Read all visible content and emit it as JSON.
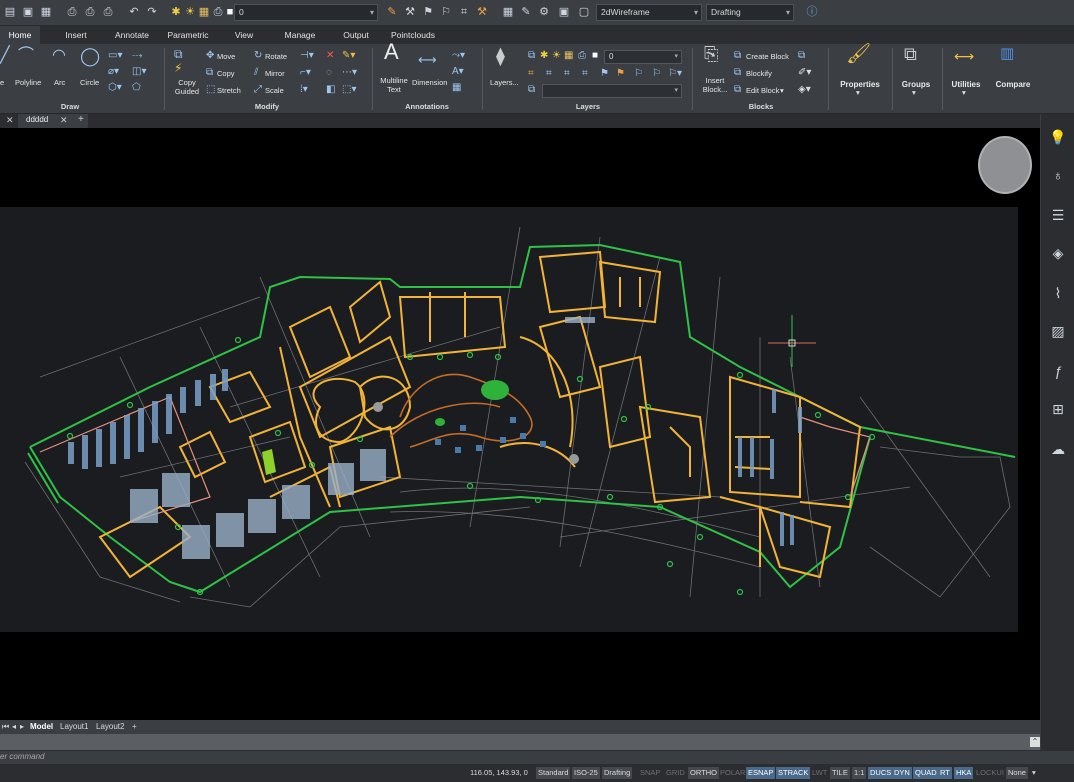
{
  "qat": {
    "layer_value": "0",
    "visual_style": "2dWireframe",
    "workspace": "Drafting"
  },
  "tabs": [
    "Home",
    "Insert",
    "Annotate",
    "Parametric",
    "View",
    "Manage",
    "Output",
    "Pointclouds"
  ],
  "ribbon": {
    "draw": {
      "label": "Draw",
      "line": "e",
      "polyline": "Polyline",
      "arc": "Arc",
      "circle": "Circle"
    },
    "modify": {
      "label": "Modify",
      "copy_guided": "Copy Guided",
      "move": "Move",
      "copy": "Copy",
      "stretch": "Stretch",
      "rotate": "Rotate",
      "mirror": "Mirror",
      "scale": "Scale"
    },
    "annotations": {
      "label": "Annotations",
      "mtext": "Multiline Text",
      "dimension": "Dimension"
    },
    "layers": {
      "label": "Layers",
      "layers_btn": "Layers...",
      "layer_value": "0"
    },
    "blocks": {
      "label": "Blocks",
      "insert": "Insert Block...",
      "create": "Create Block",
      "blockify": "Blockify",
      "edit": "Edit Block"
    },
    "properties": "Properties",
    "groups": "Groups",
    "utilities": "Utilities",
    "compare": "Compare"
  },
  "doc_tab": "ddddd",
  "layout_tabs": [
    "Model",
    "Layout1",
    "Layout2"
  ],
  "command_prompt": "er command",
  "status": {
    "coords": "116.05, 143.93, 0",
    "text_style": "Standard",
    "dim_style": "ISO-25",
    "workspace": "Drafting",
    "toggles": [
      "SNAP",
      "GRID",
      "ORTHO",
      "POLAR",
      "ESNAP",
      "STRACK",
      "LWT",
      "TILE",
      "1:1",
      "DUCS",
      "DYN",
      "QUAD",
      "RT",
      "HKA",
      "LOCKUI",
      "None"
    ]
  },
  "colors": {
    "accent": "#4a6a8c",
    "walls": "#f2b437",
    "outline": "#2ec246",
    "background": "#1b1c1f"
  }
}
